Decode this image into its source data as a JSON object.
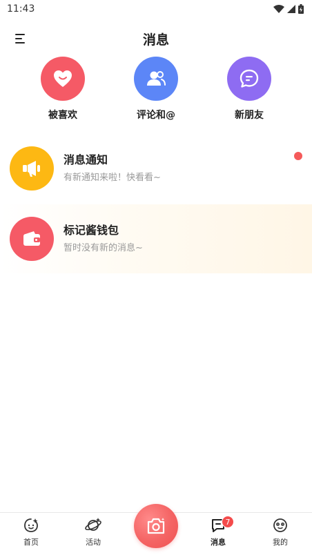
{
  "status_bar": {
    "time": "11:43"
  },
  "header": {
    "title": "消息"
  },
  "quick_actions": [
    {
      "label": "被喜欢",
      "icon": "heart-smile-icon",
      "color": "#f55a66"
    },
    {
      "label": "评论和@",
      "icon": "users-icon",
      "color": "#5c86f7"
    },
    {
      "label": "新朋友",
      "icon": "chat-bubble-icon",
      "color": "#8e6cf2"
    }
  ],
  "messages": [
    {
      "title": "消息通知",
      "subtitle": "有新通知来啦！快看看~",
      "icon": "megaphone-icon",
      "color": "#fdb813",
      "unread": true
    },
    {
      "title": "标记酱钱包",
      "subtitle": "暂时没有新的消息~",
      "icon": "wallet-icon",
      "color": "#f55a66",
      "unread": false
    }
  ],
  "tabbar": {
    "tabs": [
      {
        "label": "首页",
        "icon": "home-face-icon"
      },
      {
        "label": "活动",
        "icon": "planet-icon"
      },
      {
        "label": "消息",
        "icon": "message-icon",
        "badge": "7",
        "active": true
      },
      {
        "label": "我的",
        "icon": "profile-face-icon"
      }
    ],
    "center_icon": "camera-icon",
    "accent": "#f05252"
  }
}
